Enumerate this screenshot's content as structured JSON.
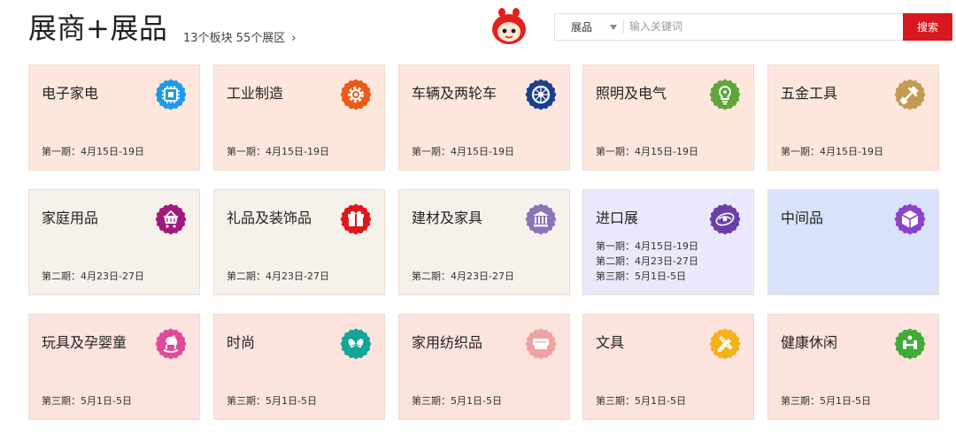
{
  "header": {
    "title": "展商+展品",
    "summary": "13个板块 55个展区",
    "summary_arrow": "›"
  },
  "search": {
    "category": "展品",
    "placeholder": "输入关键词",
    "button": "搜索"
  },
  "cards": [
    {
      "name": "电子家电",
      "dates": [
        "第一期：4月15日-19日"
      ],
      "bg": "#fde7dd",
      "icon": "chip-icon",
      "color": "#1e9be6"
    },
    {
      "name": "工业制造",
      "dates": [
        "第一期：4月15日-19日"
      ],
      "bg": "#fde7dd",
      "icon": "gear-icon",
      "color": "#ec5a17"
    },
    {
      "name": "车辆及两轮车",
      "dates": [
        "第一期：4月15日-19日"
      ],
      "bg": "#fde7dd",
      "icon": "wheel-icon",
      "color": "#1a3f8f"
    },
    {
      "name": "照明及电气",
      "dates": [
        "第一期：4月15日-19日"
      ],
      "bg": "#fde7dd",
      "icon": "bulb-icon",
      "color": "#5fa53a"
    },
    {
      "name": "五金工具",
      "dates": [
        "第一期：4月15日-19日"
      ],
      "bg": "#fde7dd",
      "icon": "tools-icon",
      "color": "#c49b54"
    },
    {
      "name": "家庭用品",
      "dates": [
        "第二期：4月23日-27日"
      ],
      "bg": "#f7f1eb",
      "icon": "basket-icon",
      "color": "#a0197d"
    },
    {
      "name": "礼品及装饰品",
      "dates": [
        "第二期：4月23日-27日"
      ],
      "bg": "#f7f1eb",
      "icon": "gift-icon",
      "color": "#e0161c"
    },
    {
      "name": "建材及家具",
      "dates": [
        "第二期：4月23日-27日"
      ],
      "bg": "#f7f1eb",
      "icon": "building-icon",
      "color": "#8c74b6"
    },
    {
      "name": "进口展",
      "dates": [
        "第一期：4月15日-19日",
        "第二期：4月23日-27日",
        "第三期：5月1日-5日"
      ],
      "bg": "#eae8fb",
      "icon": "import-icon",
      "color": "#6a3fa8"
    },
    {
      "name": "中间品",
      "dates": [],
      "bg": "#d8e3fb",
      "icon": "box-icon",
      "color": "#8a43c9"
    },
    {
      "name": "玩具及孕婴童",
      "dates": [
        "第三期：5月1日-5日"
      ],
      "bg": "#fce3dd",
      "icon": "rocking-horse-icon",
      "color": "#e1499a"
    },
    {
      "name": "时尚",
      "dates": [
        "第三期：5月1日-5日"
      ],
      "bg": "#fce3dd",
      "icon": "butterfly-icon",
      "color": "#13a59a"
    },
    {
      "name": "家用纺织品",
      "dates": [
        "第三期：5月1日-5日"
      ],
      "bg": "#fce3dd",
      "icon": "textile-icon",
      "color": "#f0a2a2"
    },
    {
      "name": "文具",
      "dates": [
        "第三期：5月1日-5日"
      ],
      "bg": "#fce3dd",
      "icon": "pencil-ruler-icon",
      "color": "#f4b21a"
    },
    {
      "name": "健康休闲",
      "dates": [
        "第三期：5月1日-5日"
      ],
      "bg": "#fce3dd",
      "icon": "dumbbell-icon",
      "color": "#3fab3a"
    }
  ]
}
